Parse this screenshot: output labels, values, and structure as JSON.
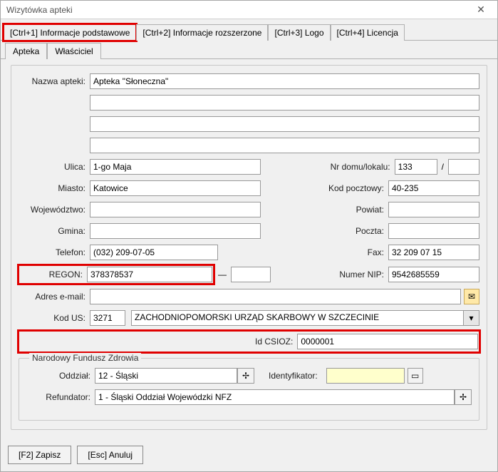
{
  "window": {
    "title": "Wizytówka apteki"
  },
  "tabs": {
    "t1": "[Ctrl+1] Informacje podstawowe",
    "t2": "[Ctrl+2] Informacje rozszerzone",
    "t3": "[Ctrl+3] Logo",
    "t4": "[Ctrl+4] Licencja"
  },
  "subtabs": {
    "apteka": "Apteka",
    "wlasciciel": "Właściciel"
  },
  "labels": {
    "nazwa": "Nazwa apteki:",
    "ulica": "Ulica:",
    "nrdom": "Nr domu/lokalu:",
    "miasto": "Miasto:",
    "kodp": "Kod pocztowy:",
    "woj": "Województwo:",
    "powiat": "Powiat:",
    "gmina": "Gmina:",
    "poczta": "Poczta:",
    "tel": "Telefon:",
    "fax": "Fax:",
    "regon": "REGON:",
    "nip": "Numer NIP:",
    "email": "Adres e-mail:",
    "kodus": "Kod US:",
    "idcsioz": "Id CSIOZ:",
    "nfz_legend": "Narodowy Fundusz Zdrowia",
    "oddzial": "Oddział:",
    "ident": "Identyfikator:",
    "refund": "Refundator:"
  },
  "values": {
    "nazwa": "Apteka \"Słoneczna\"",
    "line2": "",
    "line3": "",
    "line4": "",
    "ulica": "1-go Maja",
    "nrdom": "133",
    "lokal": "",
    "miasto": "Katowice",
    "kodp": "40-235",
    "woj": "",
    "powiat": "",
    "gmina": "",
    "poczta": "",
    "tel": "(032) 209-07-05",
    "fax": "32 209 07 15",
    "regon": "378378537",
    "regon2": "",
    "nip": "9542685559",
    "email": "",
    "kodus": "3271",
    "us_name": "ZACHODNIOPOMORSKI URZĄD SKARBOWY W SZCZECINIE",
    "idcsioz": "0000001",
    "oddzial": "12 - Śląski",
    "ident": "",
    "refund": "1 - Śląski Oddział Wojewódzki NFZ"
  },
  "buttons": {
    "save": "[F2] Zapisz",
    "cancel": "[Esc] Anuluj"
  },
  "glyphs": {
    "slash": "/",
    "dash": "—",
    "plus": "✢",
    "dropdown": "▾",
    "close": "✕",
    "mail": "✉",
    "book": "▭"
  }
}
